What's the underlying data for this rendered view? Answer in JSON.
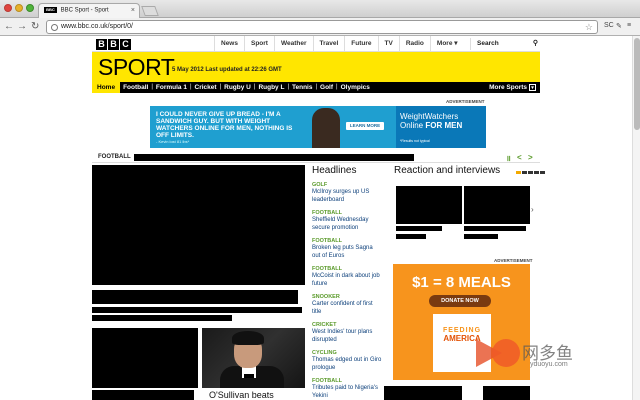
{
  "browser": {
    "tab_title": "BBC Sport - Sport",
    "tab_logo": "BBC",
    "url": "www.bbc.co.uk/sport/0/",
    "back_icon": "back-arrow-icon",
    "forward_icon": "forward-arrow-icon",
    "reload_icon": "reload-icon",
    "bookmark_icon": "star-icon"
  },
  "bbc_nav": {
    "logo": [
      "B",
      "B",
      "C"
    ],
    "items": [
      "News",
      "Sport",
      "Weather",
      "Travel",
      "Future",
      "TV",
      "Radio",
      "More"
    ],
    "search_label": "Search"
  },
  "masthead": {
    "title": "SPORT",
    "updated": "5 May 2012 Last updated at 22:26 GMT"
  },
  "sport_nav": {
    "items": [
      "Home",
      "Football",
      "Formula 1",
      "Cricket",
      "Rugby U",
      "Rugby L",
      "Tennis",
      "Golf",
      "Olympics"
    ],
    "more": "More Sports"
  },
  "ad": {
    "label": "ADVERTISEMENT",
    "headline": "I COULD NEVER GIVE UP BREAD - I'M A SANDWICH GUY. BUT WITH WEIGHT WATCHERS ONLINE FOR MEN, NOTHING IS OFF LIMITS.",
    "quote": "- Kevin lost 81 lbs*",
    "button": "LEARN MORE",
    "brand": "WeightWatchers Online",
    "brand_suffix": "FOR MEN",
    "fine_print": "*Results not typical"
  },
  "football_bar": {
    "label": "FOOTBALL"
  },
  "headlines": {
    "title": "Headlines",
    "items": [
      {
        "cat": "GOLF",
        "text": "McIlroy surges up US leaderboard"
      },
      {
        "cat": "FOOTBALL",
        "text": "Sheffield Wednesday secure promotion"
      },
      {
        "cat": "FOOTBALL",
        "text": "Broken leg puts Sagna out of Euros"
      },
      {
        "cat": "FOOTBALL",
        "text": "McCoist in dark about job future"
      },
      {
        "cat": "SNOOKER",
        "text": "Carter confident of first title"
      },
      {
        "cat": "CRICKET",
        "text": "West Indies' tour plans disrupted"
      },
      {
        "cat": "CYCLING",
        "text": "Thomas edged out in Giro prologue"
      },
      {
        "cat": "FOOTBALL",
        "text": "Tributes paid to Nigeria's Yekini"
      }
    ]
  },
  "reaction": {
    "title": "Reaction and interviews"
  },
  "meals_ad": {
    "label": "ADVERTISEMENT",
    "headline": "$1 = 8 MEALS",
    "button": "DONATE NOW",
    "logo_line1": "FEEDING",
    "logo_line2": "AMERICA"
  },
  "story": {
    "caption": "O'Sullivan beats"
  },
  "watermark": {
    "text": "网多鱼",
    "url": "yduoyu.com"
  }
}
